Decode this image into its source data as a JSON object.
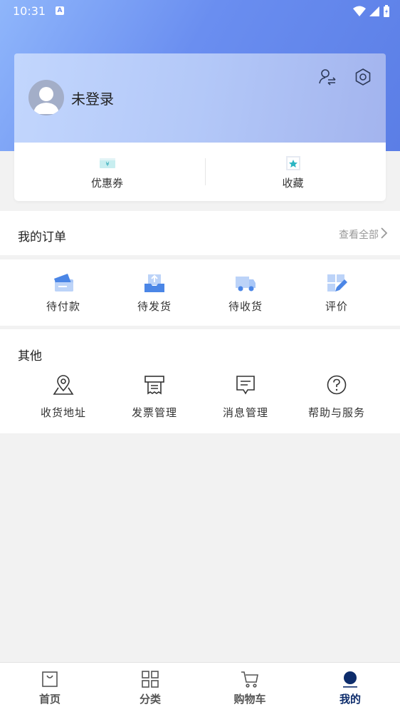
{
  "status_bar": {
    "time": "10:31",
    "indicator": "A"
  },
  "profile": {
    "login_text": "未登录"
  },
  "quick_links": [
    {
      "label": "优惠券",
      "icon": "coupon-icon"
    },
    {
      "label": "收藏",
      "icon": "favorite-star-icon"
    }
  ],
  "orders": {
    "title": "我的订单",
    "view_all": "查看全部",
    "items": [
      {
        "label": "待付款",
        "icon": "pending-payment-icon"
      },
      {
        "label": "待发货",
        "icon": "pending-shipment-icon"
      },
      {
        "label": "待收货",
        "icon": "delivery-truck-icon"
      },
      {
        "label": "评价",
        "icon": "review-pen-icon"
      }
    ]
  },
  "other": {
    "title": "其他",
    "items": [
      {
        "label": "收货地址",
        "icon": "location-pin-icon"
      },
      {
        "label": "发票管理",
        "icon": "invoice-icon"
      },
      {
        "label": "消息管理",
        "icon": "message-icon"
      },
      {
        "label": "帮助与服务",
        "icon": "help-circle-icon"
      }
    ]
  },
  "bottom_nav": [
    {
      "label": "首页",
      "icon": "home-bag-icon"
    },
    {
      "label": "分类",
      "icon": "category-grid-icon"
    },
    {
      "label": "购物车",
      "icon": "cart-icon"
    },
    {
      "label": "我的",
      "icon": "profile-dot-icon",
      "active": true
    }
  ],
  "colors": {
    "accent": "#0d2c6b",
    "hero_gradient_start": "#8fb6fb",
    "hero_gradient_end": "#5b7ee6",
    "icon_blue": "#4b86e6"
  }
}
